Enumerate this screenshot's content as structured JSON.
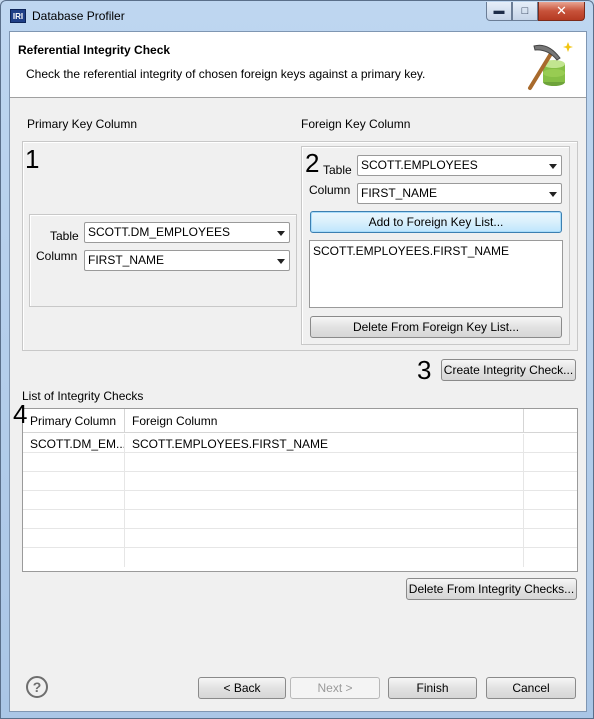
{
  "window": {
    "title": "Database Profiler",
    "app_icon_text": "IRI"
  },
  "header": {
    "title": "Referential Integrity Check",
    "description": "Check the referential integrity of chosen foreign keys against a primary key.",
    "icon": "pickaxe-database-icon"
  },
  "primary_key": {
    "section_label": "Primary Key Column",
    "step_number": "1",
    "table_label": "Table",
    "table_value": "SCOTT.DM_EMPLOYEES",
    "column_label": "Column",
    "column_value": "FIRST_NAME"
  },
  "foreign_key": {
    "section_label": "Foreign Key Column",
    "step_number": "2",
    "table_label": "Table",
    "table_value": "SCOTT.EMPLOYEES",
    "column_label": "Column",
    "column_value": "FIRST_NAME",
    "add_button": "Add to Foreign Key List...",
    "list_items": [
      "SCOTT.EMPLOYEES.FIRST_NAME"
    ],
    "delete_button": "Delete From Foreign Key List..."
  },
  "create": {
    "step_number": "3",
    "button": "Create Integrity Check..."
  },
  "checks": {
    "section_label": "List of Integrity Checks",
    "step_number": "4",
    "columns": [
      "Primary Column",
      "Foreign Column"
    ],
    "rows": [
      [
        "SCOTT.DM_EM...",
        "SCOTT.EMPLOYEES.FIRST_NAME"
      ]
    ],
    "delete_button": "Delete From Integrity Checks..."
  },
  "footer": {
    "help_icon": "help-icon",
    "back": "< Back",
    "next": "Next >",
    "finish": "Finish",
    "cancel": "Cancel"
  }
}
